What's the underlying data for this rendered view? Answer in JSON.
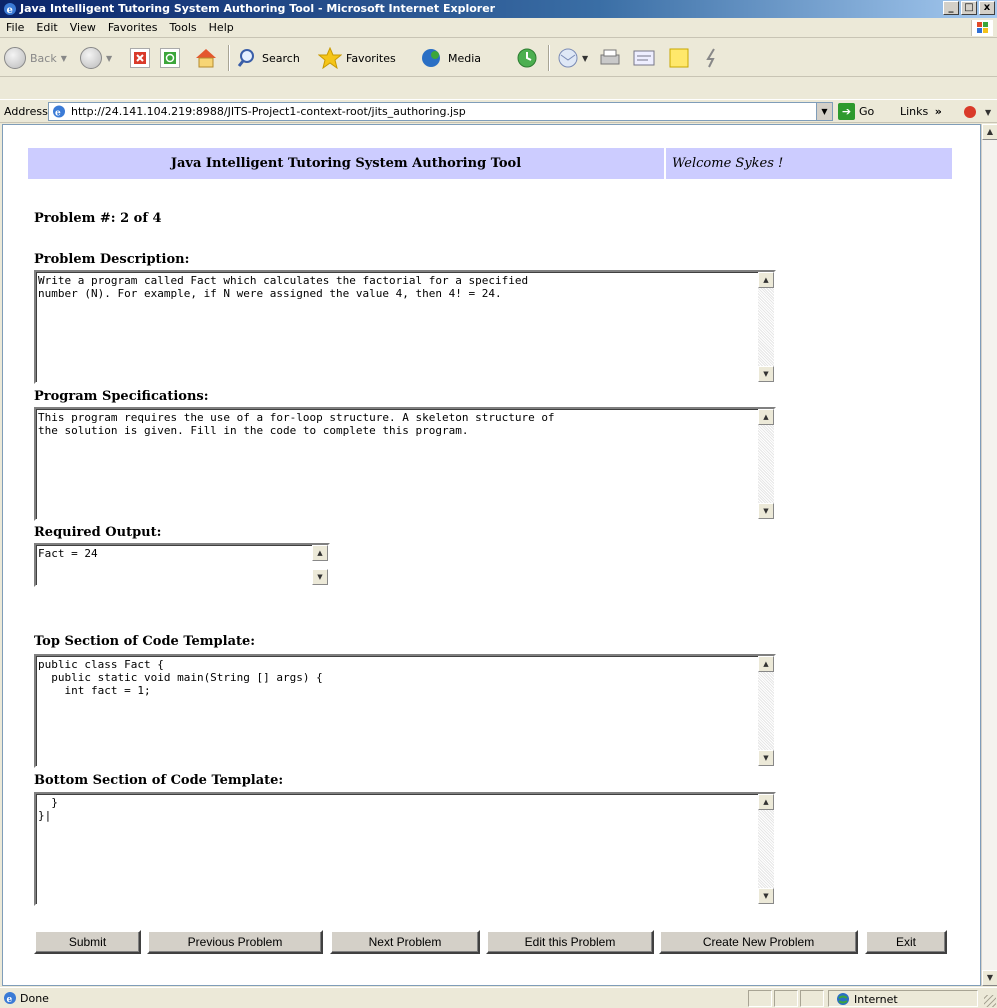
{
  "window": {
    "title": "Java Intelligent Tutoring System Authoring Tool - Microsoft Internet Explorer"
  },
  "menu": [
    "File",
    "Edit",
    "View",
    "Favorites",
    "Tools",
    "Help"
  ],
  "toolbar": {
    "back": "Back",
    "search": "Search",
    "favorites": "Favorites",
    "media": "Media"
  },
  "address": {
    "label": "Address",
    "url": "http://24.141.104.219:8988/JITS-Project1-context-root/jits_authoring.jsp",
    "go": "Go",
    "links": "Links"
  },
  "page": {
    "header_title": "Java Intelligent Tutoring System Authoring Tool",
    "welcome": "Welcome Sykes !",
    "problem_number": "Problem #: 2 of 4",
    "desc_label": "Problem Description:",
    "desc_text": "Write a program called Fact which calculates the factorial for a specified\nnumber (N). For example, if N were assigned the value 4, then 4! = 24.",
    "spec_label": "Program Specifications:",
    "spec_text": "This program requires the use of a for-loop structure. A skeleton structure of\nthe solution is given. Fill in the code to complete this program.",
    "output_label": "Required Output:",
    "output_text": "Fact = 24",
    "top_label": "Top Section of Code Template:",
    "top_text": "public class Fact {\n  public static void main(String [] args) {\n    int fact = 1;",
    "bottom_label": "Bottom Section of Code Template:",
    "bottom_text": "  }\n}|"
  },
  "buttons": {
    "submit": "Submit",
    "previous": "Previous Problem",
    "next": "Next Problem",
    "edit": "Edit this Problem",
    "create": "Create New Problem",
    "exit": "Exit"
  },
  "status": {
    "text": "Done",
    "zone": "Internet"
  }
}
